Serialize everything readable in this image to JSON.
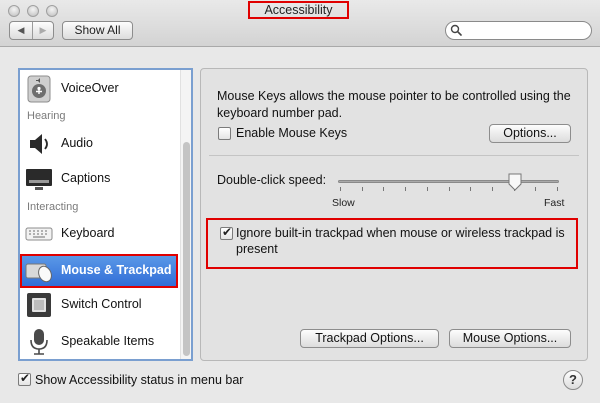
{
  "window": {
    "title": "Accessibility"
  },
  "toolbar": {
    "back_glyph": "◀",
    "forward_glyph": "▶",
    "show_all_label": "Show All",
    "search_placeholder": ""
  },
  "sidebar": {
    "items": [
      {
        "label": "VoiceOver",
        "icon": "voiceover-icon"
      },
      {
        "section": "Hearing"
      },
      {
        "label": "Audio",
        "icon": "speaker-icon"
      },
      {
        "label": "Captions",
        "icon": "captions-icon"
      },
      {
        "section": "Interacting"
      },
      {
        "label": "Keyboard",
        "icon": "keyboard-icon"
      },
      {
        "label": "Mouse & Trackpad",
        "icon": "mouse-trackpad-icon",
        "selected": true
      },
      {
        "label": "Switch Control",
        "icon": "switch-control-icon"
      },
      {
        "label": "Speakable Items",
        "icon": "microphone-icon"
      }
    ]
  },
  "main": {
    "description": "Mouse Keys allows the mouse pointer to be controlled using the keyboard number pad.",
    "enable_mouse_keys": {
      "label": "Enable Mouse Keys",
      "checked": false
    },
    "options_button": "Options...",
    "double_click": {
      "label": "Double-click speed:",
      "min_label": "Slow",
      "max_label": "Fast",
      "value": 0.8
    },
    "ignore_trackpad": {
      "label": "Ignore built-in trackpad when mouse or wireless trackpad is present",
      "checked": true
    },
    "trackpad_options_button": "Trackpad Options...",
    "mouse_options_button": "Mouse Options..."
  },
  "footer": {
    "status_in_menu_bar": {
      "label": "Show Accessibility status in menu bar",
      "checked": true
    },
    "help_label": "?"
  },
  "colors": {
    "selection": "#3b78dc",
    "highlight_outline": "#e00000"
  }
}
